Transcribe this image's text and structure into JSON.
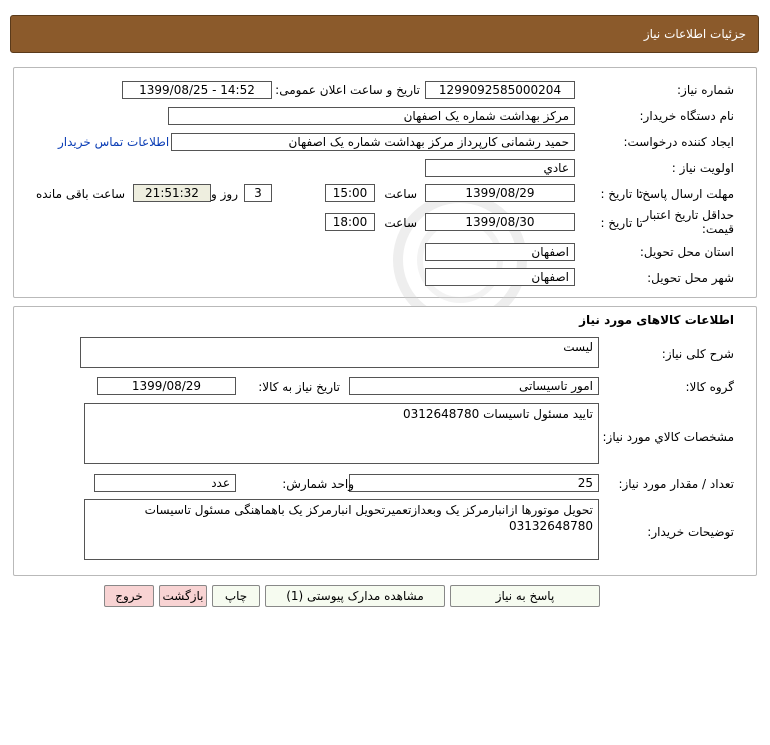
{
  "header": {
    "title": "جزئیات اطلاعات نیاز"
  },
  "info": {
    "need_number_label": "شماره نیاز:",
    "need_number": "1299092585000204",
    "announce_label": "تاریخ و ساعت اعلان عمومی:",
    "announce_value": "1399/08/25 - 14:52",
    "buyer_org_label": "نام دستگاه خریدار:",
    "buyer_org": "مرکز بهداشت شماره یک اصفهان",
    "requester_label": "ایجاد کننده درخواست:",
    "requester": "حمید رشمانی کارپرداز مرکز بهداشت شماره یک اصفهان",
    "contact_link": "اطلاعات تماس خریدار",
    "priority_label": "اولویت نیاز :",
    "priority": "عادي",
    "deadline_label": "مهلت ارسال پاسخ:",
    "to_date_label": "تا تاریخ :",
    "deadline_date": "1399/08/29",
    "time_label": "ساعت",
    "deadline_time": "15:00",
    "days_value": "3",
    "days_label": "روز و",
    "remaining_time": "21:51:32",
    "remaining_label": "ساعت باقی مانده",
    "validity_label": "حداقل تاریخ اعتبار قیمت:",
    "validity_date": "1399/08/30",
    "validity_time": "18:00",
    "province_label": "استان محل تحویل:",
    "province": "اصفهان",
    "city_label": "شهر محل تحویل:",
    "city": "اصفهان"
  },
  "goods": {
    "section_title": "اطلاعات کالاهای مورد نیاز",
    "general_desc_label": "شرح کلی نیاز:",
    "general_desc": "لیست",
    "group_label": "گروه کالا:",
    "group": "امور تاسیساتی",
    "need_date_label": "تاریخ نیاز به کالا:",
    "need_date": "1399/08/29",
    "specs_label": "مشخصات کالاي مورد نياز:",
    "specs": "تایید مسئول تاسیسات 0312648780",
    "qty_label": "تعداد / مقدار مورد نیاز:",
    "qty": "25",
    "unit_label": "واحد شمارش:",
    "unit": "عدد",
    "buyer_notes_label": "توضیحات خریدار:",
    "buyer_notes": "تحویل موتورها ازانبارمرکز یک وبعدازتعمیرتحویل انبارمرکز یک باهماهنگی مسئول تاسیسات 03132648780"
  },
  "buttons": {
    "reply": "پاسخ به نیاز",
    "attachments": "مشاهده مدارک پیوستی (1)",
    "print": "چاپ",
    "back": "بازگشت",
    "exit": "خروج"
  }
}
